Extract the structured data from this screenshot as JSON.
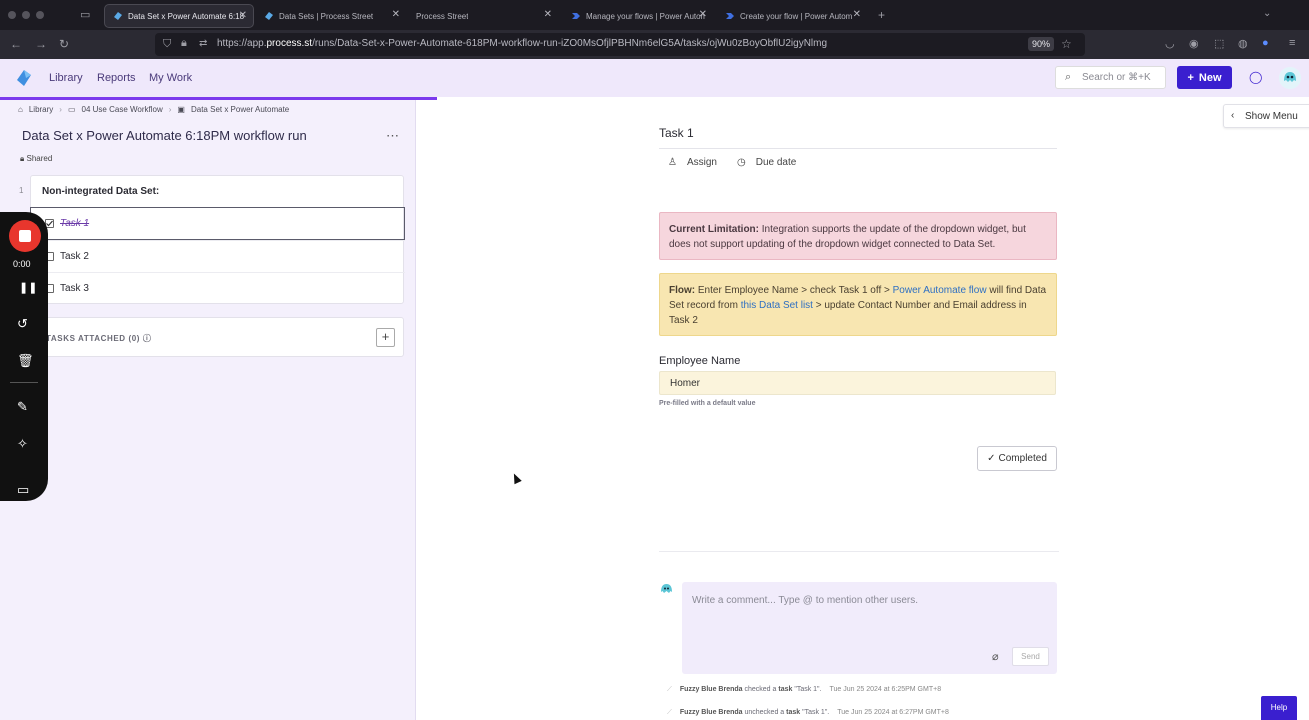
{
  "browser": {
    "tabs": [
      {
        "title": "Data Set x Power Automate 6:18"
      },
      {
        "title": "Data Sets | Process Street"
      },
      {
        "title": "Process Street"
      },
      {
        "title": "Manage your flows | Power Autom"
      },
      {
        "title": "Create your flow | Power Autom"
      }
    ],
    "url_prefix": "https://app.",
    "url_host": "process.st",
    "url_path": "/runs/Data-Set-x-Power-Automate-618PM-workflow-run-iZO0MsOfjlPBHNm6elG5A/tasks/ojWu0zBoyObflU2igyNlmg",
    "zoom": "90%"
  },
  "header": {
    "nav": [
      "Library",
      "Reports",
      "My Work"
    ],
    "search_placeholder": "Search or ⌘+K",
    "new_label": "New"
  },
  "sidebar": {
    "breadcrumbs": [
      "Library",
      "04 Use Case Workflow",
      "Data Set x Power Automate"
    ],
    "title": "Data Set x Power Automate 6:18PM workflow run",
    "shared_label": "Shared",
    "section_number": "1",
    "section_title": "Non-integrated Data Set:",
    "tasks": [
      {
        "label": "Task 1",
        "done": true
      },
      {
        "label": "Task 2",
        "done": false
      },
      {
        "label": "Task 3",
        "done": false
      }
    ],
    "attached_label": "TASKS ATTACHED (0)"
  },
  "recorder": {
    "time": "0:00"
  },
  "main": {
    "show_menu": "Show Menu",
    "task_title": "Task 1",
    "assign_label": "Assign",
    "due_date_label": "Due date",
    "limitation_bold": "Current Limitation:",
    "limitation_text": " Integration supports the update of the dropdown widget, but does not support updating of the dropdown widget connected to Data Set.",
    "flow_bold": "Flow:",
    "flow_text1": " Enter Employee Name > check Task 1 off > ",
    "flow_link1": "Power Automate flow",
    "flow_text2": " will find Data Set record from ",
    "flow_link2": "this Data Set list",
    "flow_text3": " > update Contact Number and Email address in Task 2",
    "field_label": "Employee Name",
    "field_value": "Homer",
    "field_helper": "Pre-filled with a default value",
    "completed_label": "Completed",
    "comment_placeholder": "Write a comment... Type @ to mention other users.",
    "send_label": "Send",
    "activity": [
      {
        "user": "Fuzzy Blue Brenda",
        "action": "checked a",
        "object": "task",
        "target": "\"Task 1\".",
        "time": "Tue Jun 25 2024 at 6:25PM GMT+8"
      },
      {
        "user": "Fuzzy Blue Brenda",
        "action": "unchecked a",
        "object": "task",
        "target": "\"Task 1\".",
        "time": "Tue Jun 25 2024 at 6:27PM GMT+8"
      }
    ],
    "help_label": "Help"
  },
  "colors": {
    "accent": "#3a1fcf",
    "header_bg": "#efe8fb",
    "sidebar_bg": "#f4f0fc",
    "alert_bg": "#f6d6dd",
    "flow_bg": "#f8e6b1",
    "record_red": "#e8362d"
  }
}
